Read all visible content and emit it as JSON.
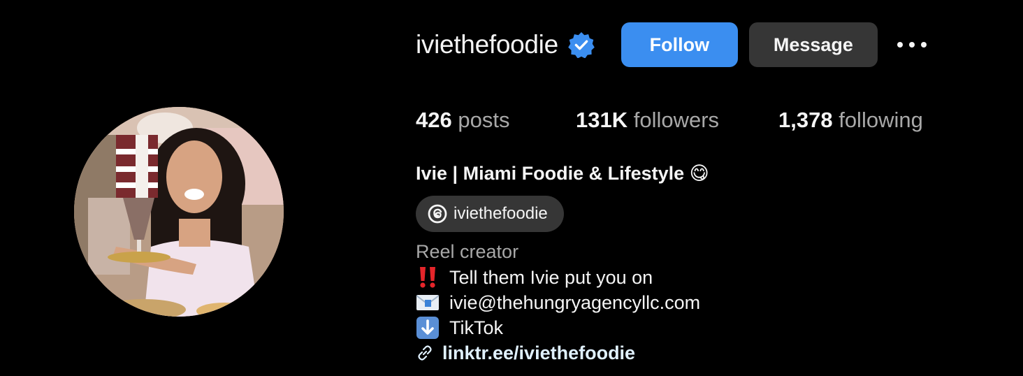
{
  "profile": {
    "username": "iviethefoodie",
    "full_name": "Ivie | Miami Foodie & Lifestyle 😋",
    "threads_handle": "iviethefoodie",
    "category": "Reel creator"
  },
  "actions": {
    "follow_label": "Follow",
    "message_label": "Message"
  },
  "stats": {
    "posts_count": "426",
    "posts_label": "posts",
    "followers_count": "131K",
    "followers_label": "followers",
    "following_count": "1,378",
    "following_label": "following"
  },
  "bio": {
    "line1": "Tell them Ivie put you on",
    "line2": "ivie@thehungryagencyllc.com",
    "line3": "TikTok",
    "link": "linktr.ee/iviethefoodie"
  },
  "icons": {
    "verified": "verified-badge-icon",
    "more": "more-options-icon",
    "threads": "threads-icon",
    "double_exclamation": "double-exclamation-icon",
    "envelope": "envelope-icon",
    "down_arrow": "down-arrow-icon",
    "link": "link-icon"
  },
  "colors": {
    "background": "#000000",
    "follow_button": "#3b8ef0",
    "secondary_button": "#363636",
    "verified_badge": "#3b8ef0",
    "muted_text": "#a8a8a8",
    "link_text": "#e0f1ff"
  }
}
